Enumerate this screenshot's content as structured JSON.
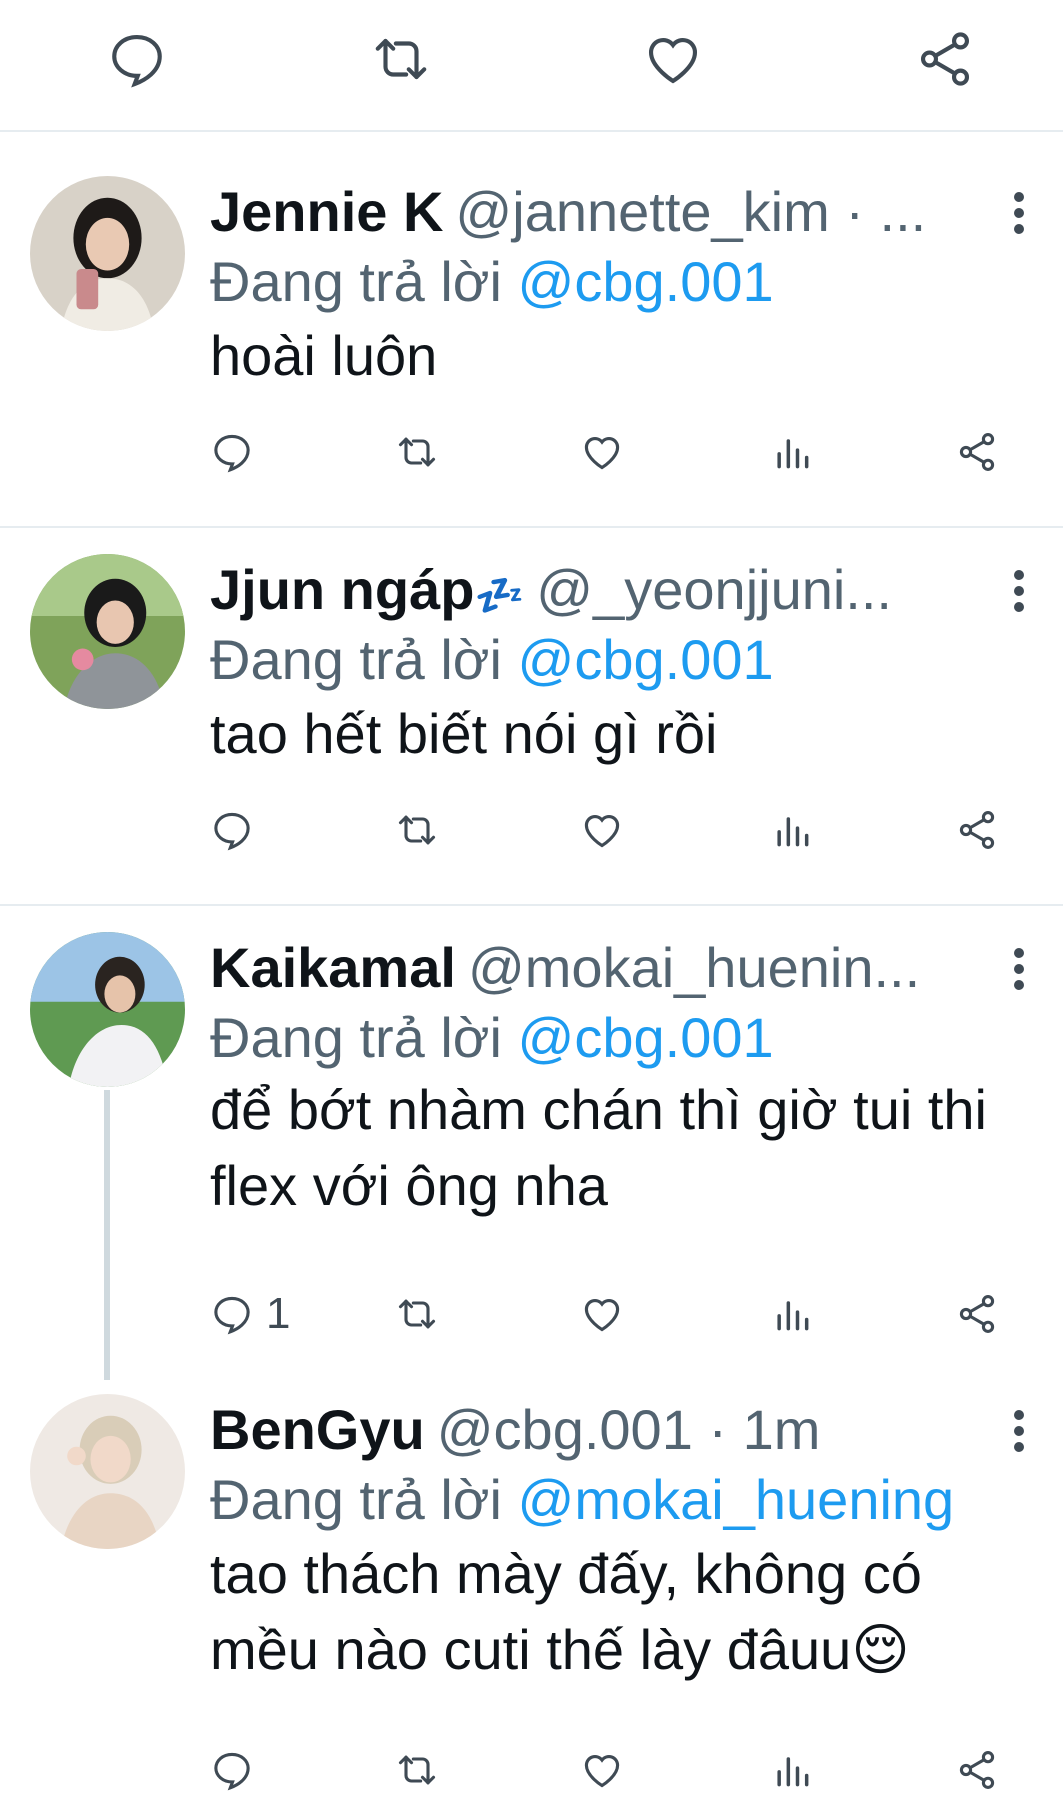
{
  "top_actions": [
    "reply-icon",
    "retweet-icon",
    "like-icon",
    "share-icon"
  ],
  "reply_prefix": "Đang trả lời",
  "tweets": [
    {
      "name": "Jennie K",
      "handle": "@jannette_kim",
      "time": "· ...",
      "reply_to": "@cbg.001",
      "text": "hoài luôn",
      "reply_count": ""
    },
    {
      "name": "Jjun ngáp",
      "name_emoji": "💤",
      "handle": "@_yeonjjuni...",
      "time": "",
      "reply_to": "@cbg.001",
      "text": "tao hết biết nói gì rồi",
      "reply_count": ""
    },
    {
      "name": "Kaikamal",
      "handle": "@mokai_huenin...",
      "time": "",
      "reply_to": "@cbg.001",
      "text": "để bớt nhàm chán thì giờ tui thi flex với ông nha",
      "reply_count": "1"
    },
    {
      "name": "BenGyu",
      "handle": "@cbg.001",
      "time": "· 1m",
      "reply_to": "@mokai_huening",
      "text": "tao thách mày đấy, không có mều nào cuti thế lày đâuu😌",
      "reply_count": ""
    }
  ],
  "colors": {
    "accent": "#1d9bf0",
    "secondary_text": "#536471",
    "divider": "#e6ecf0",
    "icon": "#3f4a54"
  }
}
